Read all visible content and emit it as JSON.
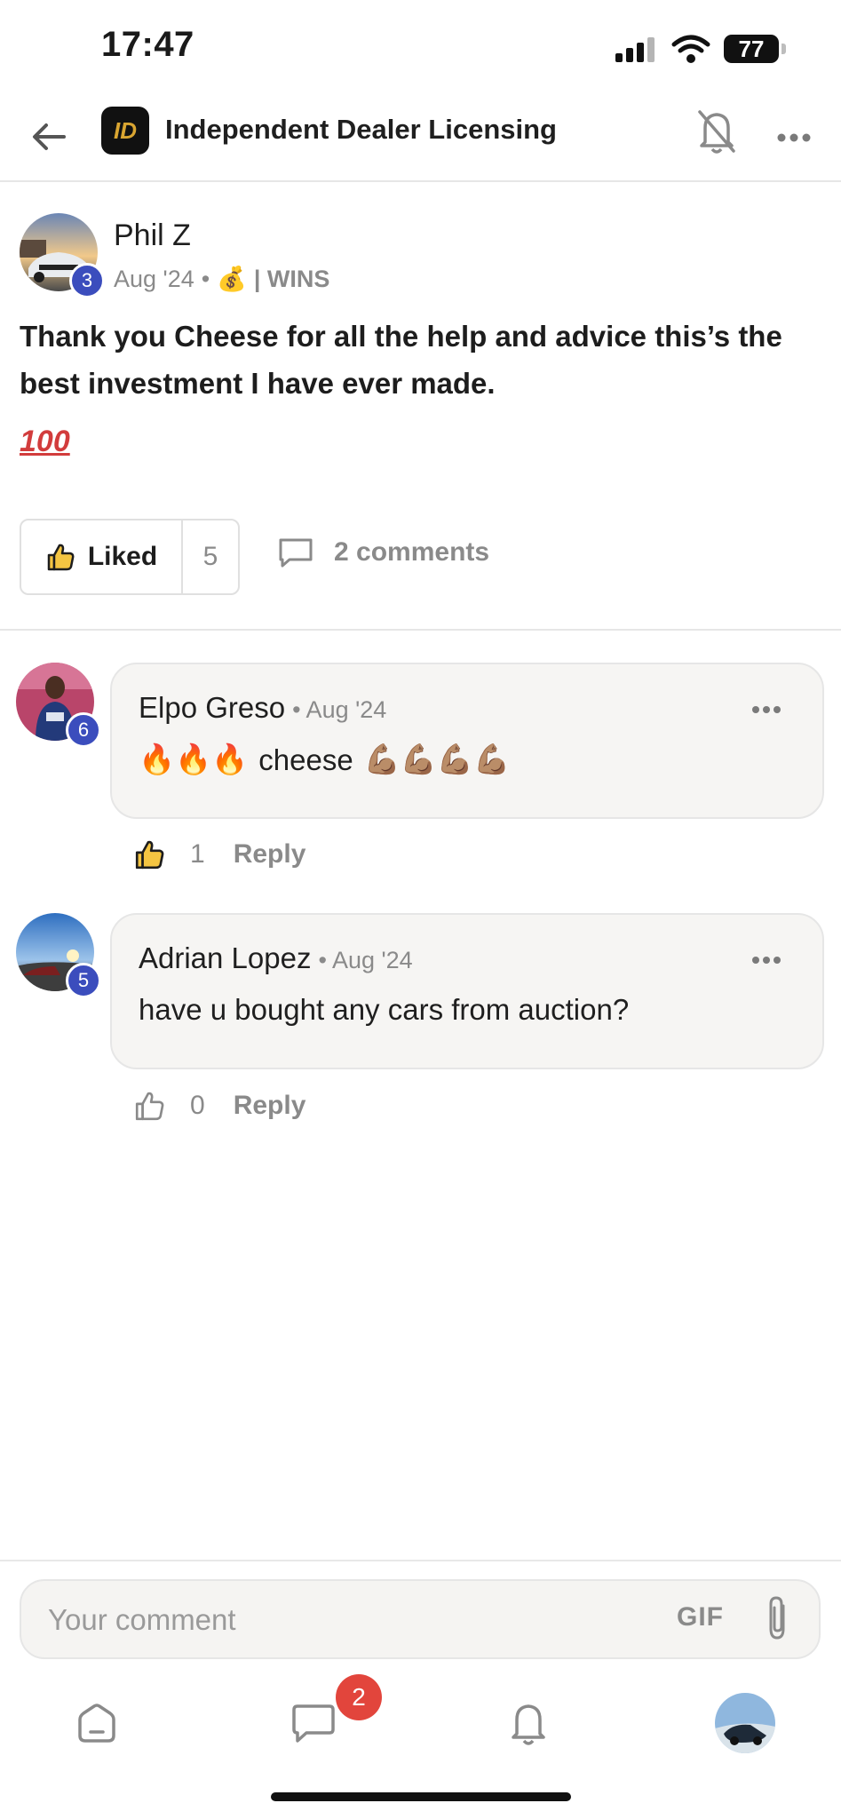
{
  "status_bar": {
    "time": "17:47",
    "battery": "77"
  },
  "header": {
    "group_name": "Independent Dealer Licensing",
    "logo_text": "ID",
    "icons": [
      "back-arrow-icon",
      "bell-off-icon",
      "more-icon"
    ]
  },
  "post": {
    "author": "Phil Z",
    "level": "3",
    "date": "Aug '24",
    "separator": "•",
    "category_emoji": "💰",
    "category": "| WINS",
    "body": "Thank you Cheese for all the help and advice this’s the best investment I have ever made.",
    "emoji": "100",
    "like_label": "Liked",
    "like_count": "5",
    "comments_label": "2 comments"
  },
  "comments": [
    {
      "author": "Elpo Greso",
      "level": "6",
      "date": "• Aug '24",
      "text_prefix": "🔥🔥🔥",
      "text": "cheese",
      "text_suffix": "💪🏽💪🏽💪🏽💪🏽",
      "like_count": "1",
      "reply_label": "Reply",
      "liked": true
    },
    {
      "author": "Adrian Lopez",
      "level": "5",
      "date": "• Aug '24",
      "text": "have u bought any cars from auction?",
      "like_count": "0",
      "reply_label": "Reply",
      "liked": false
    }
  ],
  "composer": {
    "placeholder": "Your comment",
    "gif_label": "GIF"
  },
  "tab_bar": {
    "unread_count": "2"
  },
  "colors": {
    "accent_badge": "#3b4dbd",
    "notification": "#e2453c",
    "bubble_bg": "#f6f5f3"
  }
}
